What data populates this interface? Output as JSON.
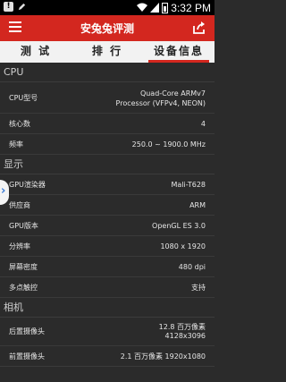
{
  "status_bar": {
    "time": "3:32 PM",
    "icons": [
      "warning-icon",
      "edit-pen-icon",
      "wifi-icon",
      "signal-icon",
      "battery-icon"
    ]
  },
  "app_bar": {
    "title": "安兔兔评测",
    "menu_icon": "hamburger-menu-icon",
    "share_icon": "share-icon",
    "color": "#d3271f"
  },
  "tabs": [
    {
      "label": "测 试",
      "active": false
    },
    {
      "label": "排 行",
      "active": false
    },
    {
      "label": "设备信息",
      "active": true
    }
  ],
  "sections": {
    "cpu": {
      "title": "CPU",
      "rows": [
        {
          "key": "CPU型号",
          "value_line1": "Quad-Core ARMv7",
          "value_line2": "Processor (VFPv4, NEON)"
        },
        {
          "key": "核心数",
          "value": "4"
        },
        {
          "key": "频率",
          "value": "250.0 ~ 1900.0 MHz"
        }
      ]
    },
    "display": {
      "title": "显示",
      "rows": [
        {
          "key": "GPU渲染器",
          "value": "Mali-T628"
        },
        {
          "key": "供应商",
          "value": "ARM"
        },
        {
          "key": "GPU版本",
          "value": "OpenGL ES 3.0"
        },
        {
          "key": "分辨率",
          "value": "1080 x 1920"
        },
        {
          "key": "屏幕密度",
          "value": "480 dpi"
        },
        {
          "key": "多点触控",
          "value": "支持"
        }
      ]
    },
    "camera": {
      "title": "相机",
      "rows": [
        {
          "key": "后置摄像头",
          "value_line1": "12.8 百万像素",
          "value_line2": "4128x3096"
        },
        {
          "key": "前置摄像头",
          "value": "2.1 百万像素  1920x1080"
        }
      ]
    }
  }
}
